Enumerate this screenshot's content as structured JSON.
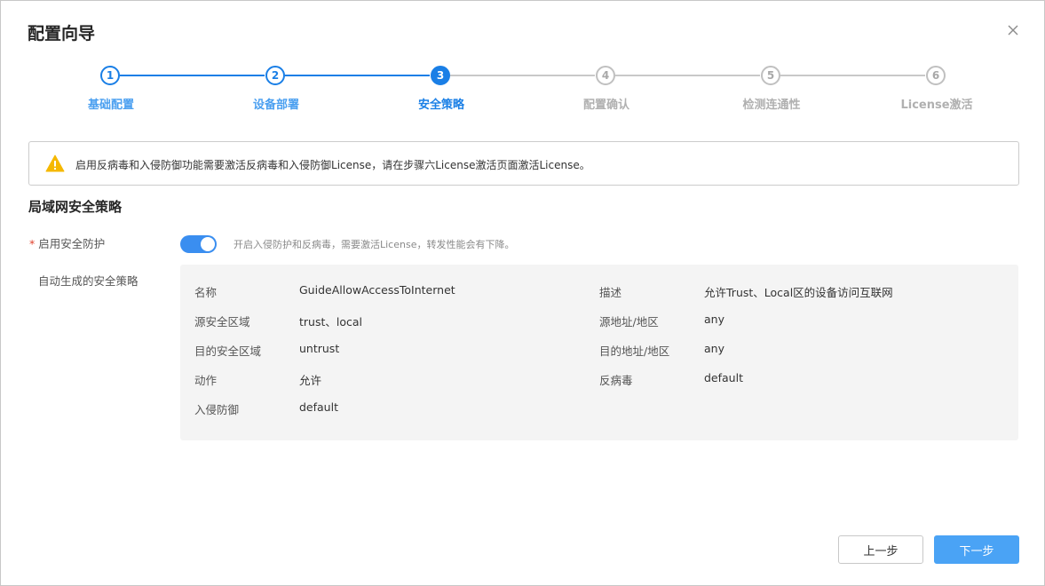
{
  "dialog": {
    "title": "配置向导"
  },
  "steps": [
    {
      "number": "1",
      "label": "基础配置",
      "state": "done"
    },
    {
      "number": "2",
      "label": "设备部署",
      "state": "done"
    },
    {
      "number": "3",
      "label": "安全策略",
      "state": "active"
    },
    {
      "number": "4",
      "label": "配置确认",
      "state": "pending"
    },
    {
      "number": "5",
      "label": "检测连通性",
      "state": "pending"
    },
    {
      "number": "6",
      "label": "License激活",
      "state": "pending"
    }
  ],
  "alert": {
    "icon": "warning-icon",
    "text": "启用反病毒和入侵防御功能需要激活反病毒和入侵防御License，请在步骤六License激活页面激活License。"
  },
  "section": {
    "title": "局域网安全策略"
  },
  "enable_protection": {
    "required_mark": "*",
    "label": "启用安全防护",
    "enabled": true,
    "hint": "开启入侵防护和反病毒，需要激活License，转发性能会有下降。"
  },
  "auto_policy": {
    "label": "自动生成的安全策略",
    "fields": {
      "name": {
        "key": "名称",
        "value": "GuideAllowAccessToInternet"
      },
      "description": {
        "key": "描述",
        "value": "允许Trust、Local区的设备访问互联网"
      },
      "src_zone": {
        "key": "源安全区域",
        "value": "trust、local"
      },
      "src_addr": {
        "key": "源地址/地区",
        "value": "any"
      },
      "dst_zone": {
        "key": "目的安全区域",
        "value": "untrust"
      },
      "dst_addr": {
        "key": "目的地址/地区",
        "value": "any"
      },
      "action": {
        "key": "动作",
        "value": "允许"
      },
      "antivirus": {
        "key": "反病毒",
        "value": "default"
      },
      "ips": {
        "key": "入侵防御",
        "value": "default"
      }
    }
  },
  "buttons": {
    "prev": "上一步",
    "next": "下一步"
  },
  "colors": {
    "primary": "#1a7fe6",
    "button_primary": "#4aa3f5",
    "warning": "#f5b800",
    "required": "#e0412c",
    "panel_bg": "#f4f4f4"
  }
}
